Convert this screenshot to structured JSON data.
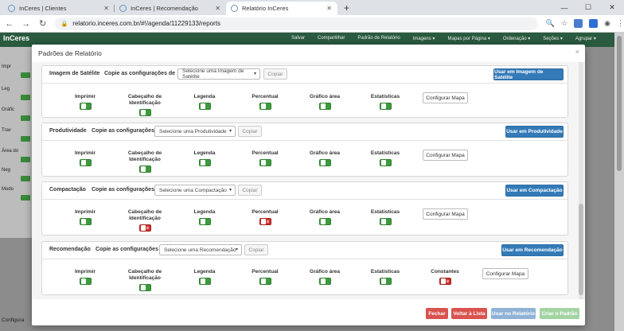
{
  "browser": {
    "tabs": [
      {
        "label": "InCeres | Clientes"
      },
      {
        "label": "InCeres | Recomendação"
      },
      {
        "label": "Relatório InCeres"
      }
    ],
    "url": "relatorio.inceres.com.br/#!/agenda/11229133/reports"
  },
  "app": {
    "logo": "InCeres",
    "nav_items": [
      "Salvar",
      "Compartilhar",
      "Padrão de Relatório",
      "Imagens ▾",
      "Mapas por Página ▾",
      "Ordenação ▾",
      "Seções ▾",
      "Agrupar ▾"
    ],
    "side_labels": [
      "Impr",
      "Leg",
      "Gráfic",
      "Trav",
      "Área do",
      "Neg",
      "Modo"
    ],
    "bottom_label": "Configura"
  },
  "modal": {
    "title": "Padrões de Relatório",
    "close_glyph": "×",
    "copy_label": "Copie as configurações de",
    "copy_button": "Copiar",
    "config_button": "Configurar Mapa",
    "sections": [
      {
        "title": "Imagem de Satélite",
        "select_placeholder": "Selecione uma Imagem de Satélite",
        "use_button": "Usar em Imagem de Satélite",
        "options": [
          {
            "label": "Imprimir",
            "on": true
          },
          {
            "label": "Cabeçalho de Identificação",
            "on": true
          },
          {
            "label": "Legenda",
            "on": true
          },
          {
            "label": "Percentual",
            "on": true
          },
          {
            "label": "Gráfico área",
            "on": true
          },
          {
            "label": "Estatísticas",
            "on": true
          }
        ]
      },
      {
        "title": "Produtividade",
        "select_placeholder": "Selecione uma Produtividade",
        "use_button": "Usar em Produtividade",
        "options": [
          {
            "label": "Imprimir",
            "on": true
          },
          {
            "label": "Cabeçalho de Identificação",
            "on": true
          },
          {
            "label": "Legenda",
            "on": true
          },
          {
            "label": "Percentual",
            "on": true
          },
          {
            "label": "Gráfico área",
            "on": true
          },
          {
            "label": "Estatísticas",
            "on": true
          }
        ]
      },
      {
        "title": "Compactação",
        "select_placeholder": "Selecione uma Compactação",
        "use_button": "Usar em Compactação",
        "options": [
          {
            "label": "Imprimir",
            "on": true
          },
          {
            "label": "Cabeçalho de Identificação",
            "on": false
          },
          {
            "label": "Legenda",
            "on": true
          },
          {
            "label": "Percentual",
            "on": false
          },
          {
            "label": "Gráfico área",
            "on": true
          },
          {
            "label": "Estatísticas",
            "on": true
          }
        ]
      },
      {
        "title": "Recomendação",
        "select_placeholder": "Selecione uma Recomendação",
        "use_button": "Usar em Recomendação",
        "options": [
          {
            "label": "Imprimir",
            "on": true
          },
          {
            "label": "Cabeçalho de Identificação",
            "on": true
          },
          {
            "label": "Legenda",
            "on": true
          },
          {
            "label": "Percentual",
            "on": true
          },
          {
            "label": "Gráfico área",
            "on": true
          },
          {
            "label": "Estatísticas",
            "on": true
          },
          {
            "label": "Constantes",
            "on": false
          }
        ]
      }
    ],
    "footer": {
      "close": "Fechar",
      "back": "Voltar à Lista",
      "use_report": "Usar no Relatório",
      "create_default": "Criar o Padrão"
    },
    "colors": {
      "primary": "#337ab7",
      "danger": "#d9534f",
      "success": "#5cb85c",
      "toggle_on": "#3e9a3e",
      "toggle_off": "#c9302c"
    }
  }
}
